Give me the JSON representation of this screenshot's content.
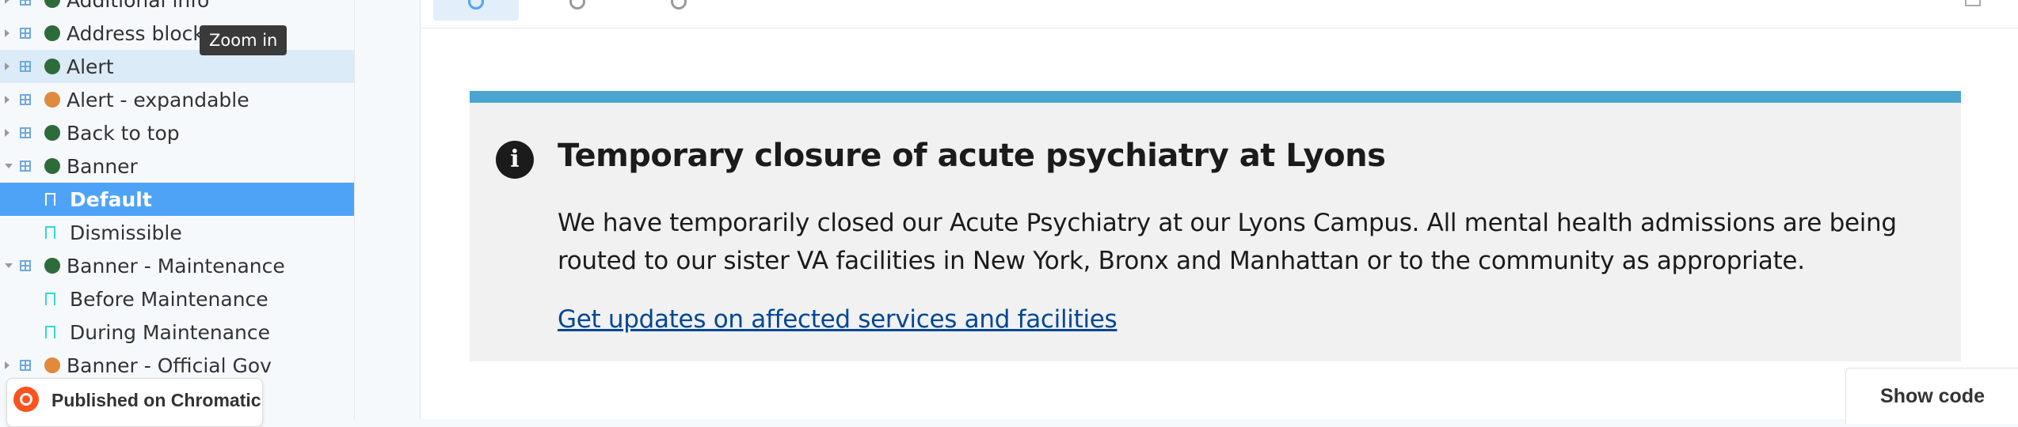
{
  "sidebar": {
    "items": [
      {
        "label": "Additional info",
        "kind": "component",
        "dot": "#2e6b3a",
        "expanded": false,
        "state": "normal"
      },
      {
        "label": "Address block",
        "kind": "component",
        "dot": "#2e6b3a",
        "expanded": false,
        "state": "normal"
      },
      {
        "label": "Alert",
        "kind": "component",
        "dot": "#2e6b3a",
        "expanded": false,
        "state": "hover"
      },
      {
        "label": "Alert - expandable",
        "kind": "component",
        "dot": "#e08a3c",
        "expanded": false,
        "state": "normal"
      },
      {
        "label": "Back to top",
        "kind": "component",
        "dot": "#2e6b3a",
        "expanded": false,
        "state": "normal"
      },
      {
        "label": "Banner",
        "kind": "component",
        "dot": "#2e6b3a",
        "expanded": true,
        "state": "normal"
      },
      {
        "label": "Default",
        "kind": "story",
        "state": "selected"
      },
      {
        "label": "Dismissible",
        "kind": "story",
        "state": "normal"
      },
      {
        "label": "Banner - Maintenance",
        "kind": "component",
        "dot": "#2e6b3a",
        "expanded": true,
        "state": "normal"
      },
      {
        "label": "Before Maintenance",
        "kind": "story",
        "state": "normal"
      },
      {
        "label": "During Maintenance",
        "kind": "story",
        "state": "normal"
      },
      {
        "label": "Banner - Official Gov",
        "kind": "component",
        "dot": "#e08a3c",
        "expanded": false,
        "state": "normal"
      }
    ]
  },
  "tooltip": {
    "text": "Zoom in"
  },
  "badge": {
    "text": "Published on Chromatic"
  },
  "toolbar": {
    "icons": [
      "zoom-in-icon",
      "zoom-out-icon",
      "zoom-reset-icon",
      "fullscreen-icon"
    ]
  },
  "alert": {
    "title": "Temporary closure of acute psychiatry at Lyons",
    "body": "We have temporarily closed our Acute Psychiatry at our Lyons Campus. All mental health admissions are being routed to our sister VA facilities in New York, Bronx and Manhattan or to the community as appropriate.",
    "link": "Get updates on affected services and facilities",
    "icon_glyph": "i"
  },
  "show_code": {
    "label": "Show code"
  },
  "colors": {
    "accent": "#4fa3f7",
    "alert_border": "#4aa6d1",
    "link": "#004795",
    "chromatic": "#fc521f"
  }
}
